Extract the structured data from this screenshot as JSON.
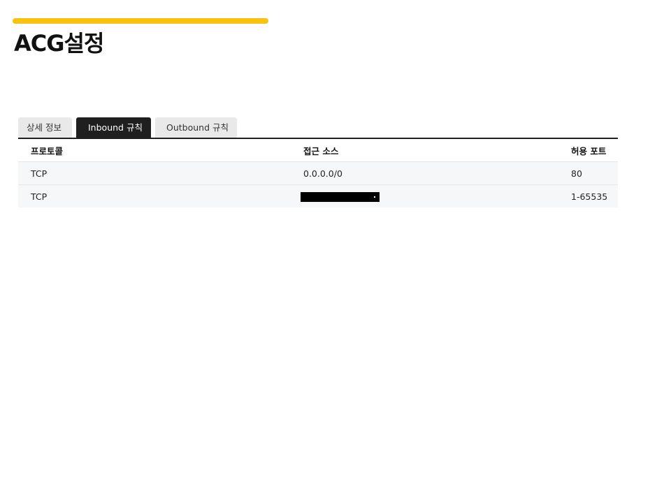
{
  "colors": {
    "accent": "#f7c30f",
    "tab_active_bg": "#1f1f1f",
    "tab_inactive_bg": "#e9e9e9",
    "row_bg": "#f6f7f8"
  },
  "page": {
    "title": "ACG설정"
  },
  "tabs": [
    {
      "label": "상세 정보",
      "active": false
    },
    {
      "label": "Inbound 규칙",
      "active": true
    },
    {
      "label": "Outbound 규칙",
      "active": false
    }
  ],
  "table": {
    "headers": {
      "protocol": "프로토콜",
      "source": "접근 소스",
      "port": "허용 포트"
    },
    "rows": [
      {
        "protocol": "TCP",
        "source": "0.0.0.0/0",
        "port": "80",
        "redacted": false
      },
      {
        "protocol": "TCP",
        "source": "",
        "port": "1-65535",
        "redacted": true
      }
    ]
  }
}
